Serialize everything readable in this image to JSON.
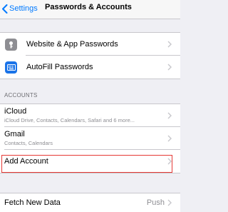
{
  "nav": {
    "back_label": "Settings",
    "title": "Passwords & Accounts"
  },
  "group1": [
    {
      "label": "Website & App Passwords",
      "icon": "key-icon"
    },
    {
      "label": "AutoFill Passwords",
      "icon": "keyboard-icon"
    }
  ],
  "accounts_header": "ACCOUNTS",
  "accounts": [
    {
      "title": "iCloud",
      "subtitle": "iCloud Drive, Contacts, Calendars, Safari and 6 more..."
    },
    {
      "title": "Gmail",
      "subtitle": "Contacts, Calendars"
    }
  ],
  "add_account_label": "Add Account",
  "fetch": {
    "label": "Fetch New Data",
    "value": "Push"
  },
  "colors": {
    "accent": "#007aff",
    "highlight": "#e53935",
    "background": "#efeff4"
  }
}
